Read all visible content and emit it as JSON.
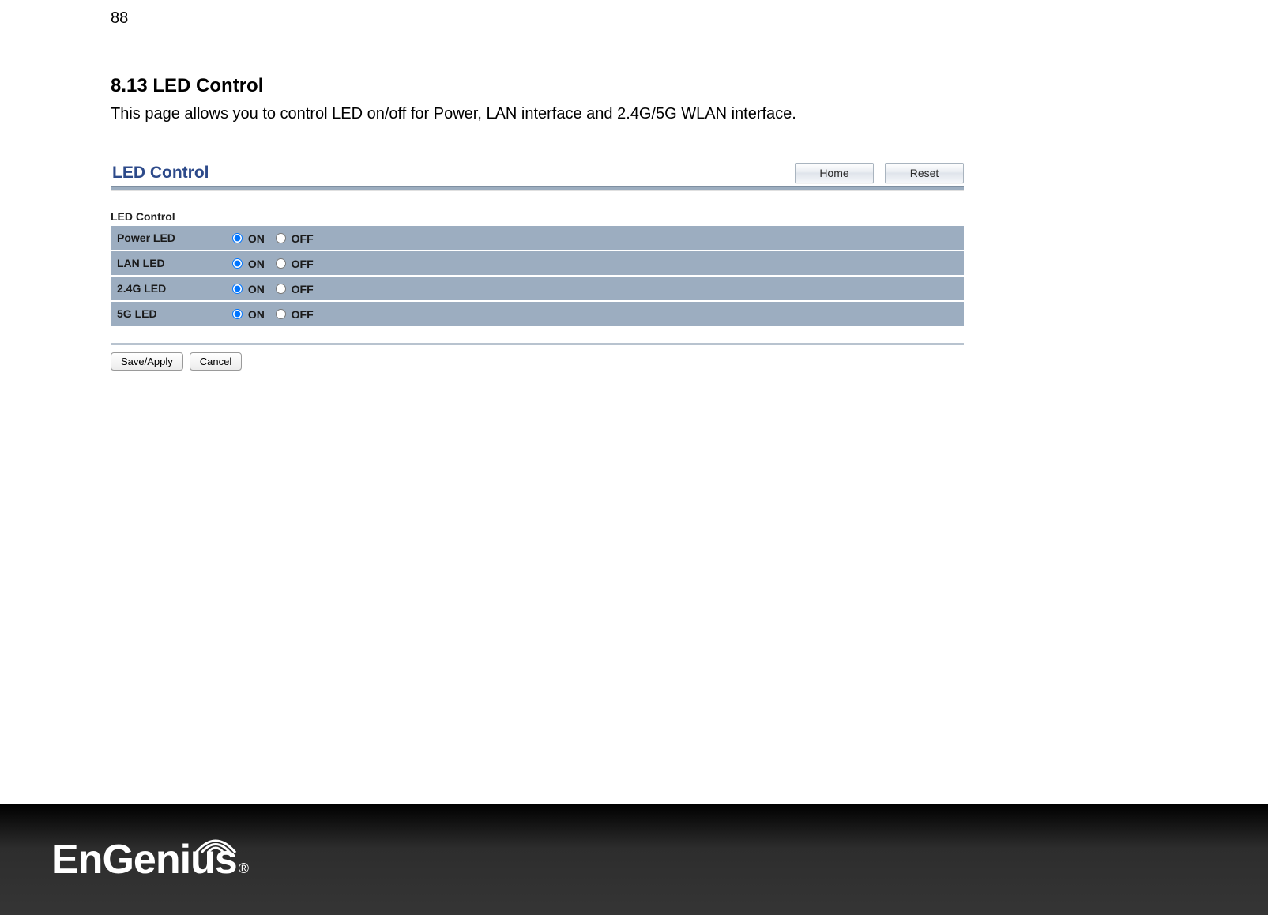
{
  "page_number": "88",
  "section": {
    "heading": "8.13 LED Control",
    "description": "This page allows you to control LED on/off for Power, LAN interface and 2.4G/5G WLAN interface."
  },
  "panel": {
    "title": "LED Control",
    "top_buttons": {
      "home": "Home",
      "reset": "Reset"
    },
    "sub_heading": "LED Control",
    "on_label": "ON",
    "off_label": "OFF",
    "rows": [
      {
        "label": "Power LED",
        "selected": "on"
      },
      {
        "label": "LAN LED",
        "selected": "on"
      },
      {
        "label": "2.4G LED",
        "selected": "on"
      },
      {
        "label": "5G LED",
        "selected": "on"
      }
    ],
    "actions": {
      "save_apply": "Save/Apply",
      "cancel": "Cancel"
    }
  },
  "footer": {
    "brand": "EnGenius",
    "registered": "®"
  }
}
